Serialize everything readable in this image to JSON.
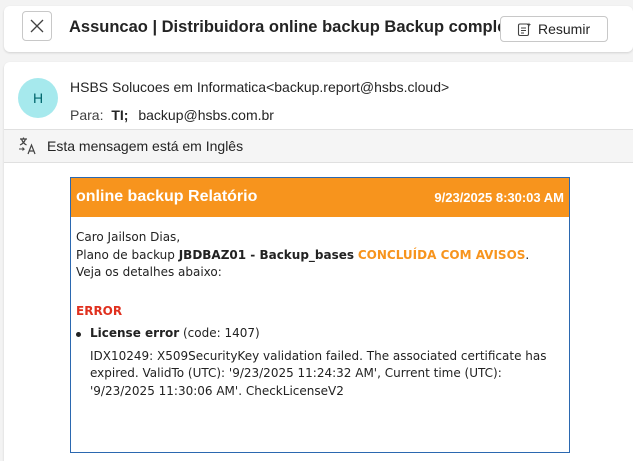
{
  "header": {
    "subject": "Assuncao | Distribuidora online backup Backup completed",
    "summarize_label": "Resumir"
  },
  "message": {
    "avatar_initial": "H",
    "sender": "HSBS Solucoes em Informatica<backup.report@hsbs.cloud>",
    "to_label": "Para:",
    "to_name": "TI;",
    "to_email": "backup@hsbs.com.br"
  },
  "translation": {
    "text": "Esta mensagem está em Inglês"
  },
  "report": {
    "title": "online backup Relatório",
    "datetime": "9/23/2025 8:30:03 AM",
    "greeting": "Caro Jailson Dias,",
    "plan_prefix": "Plano de backup",
    "plan_name": "JBDBAZ01 - Backup_bases",
    "status": "CONCLUÍDA COM AVISOS",
    "status_suffix": ".",
    "details_text": "Veja os detalhes abaixo:",
    "error_heading": "ERROR",
    "error_name": "License error",
    "error_code": "(code: 1407)",
    "error_message": "IDX10249: X509SecurityKey validation failed. The associated certificate has expired. ValidTo (UTC): '9/23/2025 11:24:32 AM', Current time (UTC): '9/23/2025 11:30:06 AM'. CheckLicenseV2"
  },
  "colors": {
    "report_header_bg": "#f7941d",
    "report_border": "#2b68b0",
    "status_warning": "#f7941d",
    "error_red": "#e0301e",
    "avatar_bg": "#a6e9ed"
  },
  "icons": {
    "close": "close-icon",
    "summarize": "summarize-icon",
    "translate": "translate-icon"
  }
}
